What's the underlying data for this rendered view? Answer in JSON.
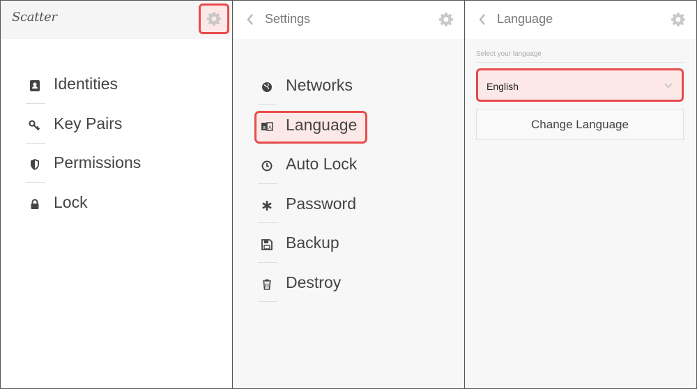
{
  "panel1": {
    "logo_text": "Scatter",
    "menu": [
      {
        "label": "Identities",
        "icon": "identity-card-icon"
      },
      {
        "label": "Key Pairs",
        "icon": "key-icon"
      },
      {
        "label": "Permissions",
        "icon": "shield-icon"
      },
      {
        "label": "Lock",
        "icon": "lock-icon"
      }
    ],
    "settings_icon": "gear-icon"
  },
  "panel2": {
    "title": "Settings",
    "menu": [
      {
        "label": "Networks",
        "icon": "globe-icon"
      },
      {
        "label": "Language",
        "icon": "language-icon"
      },
      {
        "label": "Auto Lock",
        "icon": "clock-icon"
      },
      {
        "label": "Password",
        "icon": "asterisk-icon"
      },
      {
        "label": "Backup",
        "icon": "floppy-disk-icon"
      },
      {
        "label": "Destroy",
        "icon": "trash-icon"
      }
    ],
    "selected": "Language"
  },
  "panel3": {
    "title": "Language",
    "field_label": "Select your language",
    "selected_language": "English",
    "change_button": "Change Language"
  },
  "colors": {
    "highlight_border": "#e84b4b",
    "highlight_fill": "#fde8e8",
    "text": "#444444",
    "icon_gray": "#cccccc"
  }
}
